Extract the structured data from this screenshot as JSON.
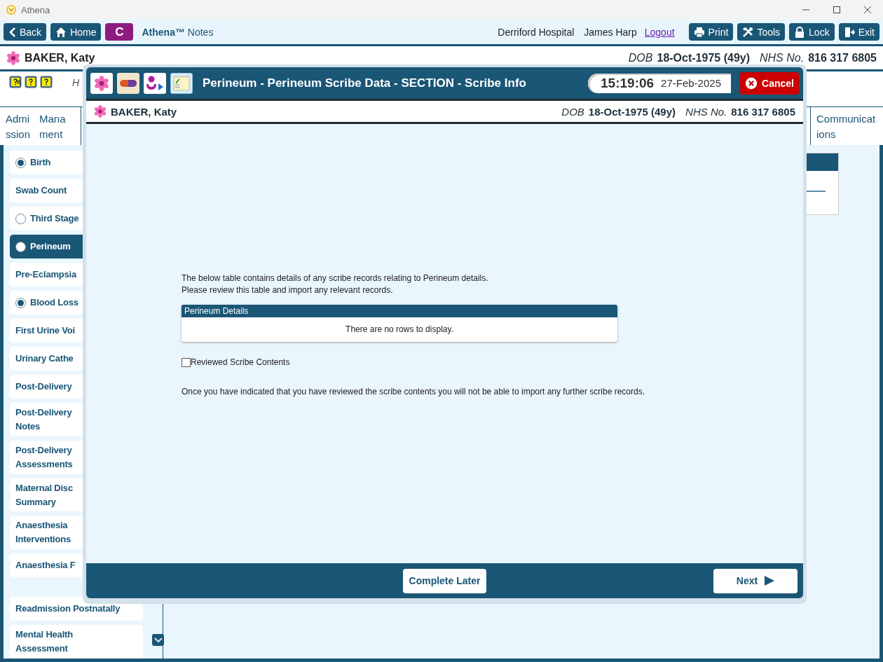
{
  "window": {
    "title": "Athena"
  },
  "toolbar": {
    "nav_buttons": [
      {
        "kind": "back",
        "label": "Back"
      },
      {
        "kind": "home",
        "label": "Home"
      },
      {
        "kind": "letter",
        "label": "C"
      }
    ],
    "app_name": "**Athena™** Notes",
    "hospital": "Derriford Hospital",
    "user": "James Harp",
    "logout": "Logout",
    "actions": [
      {
        "kind": "print",
        "label": "Print"
      },
      {
        "kind": "tools",
        "label": "Tools"
      },
      {
        "kind": "lock",
        "label": "Lock"
      },
      {
        "kind": "exit",
        "label": "Exit"
      }
    ]
  },
  "patient": {
    "name": "BAKER, Katy",
    "dob_label": "DOB",
    "dob": "18-Oct-1975 (49y)",
    "nhs_label": "NHS No.",
    "nhs": "816 317 6805"
  },
  "info_row": {
    "text": "H"
  },
  "tabs": [
    {
      "label": "Admission",
      "selected": false
    },
    {
      "label": "Mana\nment",
      "selected": false
    },
    {
      "label": "Communications",
      "selected": false
    }
  ],
  "sidebar": {
    "items": [
      {
        "label": "Birth",
        "kind": "radio",
        "checked": true,
        "selected": false
      },
      {
        "label": "Swab Count",
        "kind": "plain",
        "selected": false
      },
      {
        "label": "Third Stage",
        "kind": "radio",
        "checked": false,
        "selected": false
      },
      {
        "label": "Perineum",
        "kind": "radio",
        "checked": false,
        "selected": true
      },
      {
        "label": "Pre-Eclampsia",
        "kind": "plain",
        "selected": false
      },
      {
        "label": "Blood Loss",
        "kind": "radio",
        "checked": true,
        "selected": false
      },
      {
        "label": "First Urine Voi",
        "kind": "plain",
        "selected": false
      },
      {
        "label": "Urinary Cathe",
        "kind": "plain",
        "selected": false
      },
      {
        "label": "Post-Delivery",
        "kind": "plain",
        "selected": false
      },
      {
        "label": "Post-Delivery\nNotes",
        "kind": "plain",
        "selected": false
      },
      {
        "label": "Post-Delivery\nAssessments",
        "kind": "plain",
        "selected": false
      },
      {
        "label": "Maternal Disc\nSummary",
        "kind": "plain",
        "selected": false
      },
      {
        "label": "Anaesthesia\nInterventions",
        "kind": "plain",
        "selected": false
      },
      {
        "label": "Anaesthesia F",
        "kind": "plain",
        "selected": false
      },
      {
        "label": "Readmission Postnatally",
        "kind": "plain",
        "selected": false
      },
      {
        "label": "Mental Health\nAssessment",
        "kind": "plain",
        "selected": false
      }
    ]
  },
  "dialog": {
    "title": "Perineum - Perineum Scribe Data - SECTION - Scribe Info",
    "time": "15:19:06",
    "date": "27-Feb-2025",
    "cancel": "Cancel",
    "patient": {
      "name": "BAKER, Katy",
      "dob_label": "DOB",
      "dob": "18-Oct-1975 (49y)",
      "nhs_label": "NHS No.",
      "nhs": "816 317 6805"
    },
    "intro": [
      "The below table contains details of any scribe records relating to Perineum details.",
      "Please review this table and import any relevant records."
    ],
    "table": {
      "title": "Perineum Details",
      "empty_text": "There are no rows to display."
    },
    "reviewed": {
      "label": "Reviewed Scribe Contents",
      "checked": false
    },
    "note": "Once you have indicated that you have reviewed the scribe contents you will not be able to import any further scribe records.",
    "complete_later": "Complete Later",
    "next": "Next"
  }
}
